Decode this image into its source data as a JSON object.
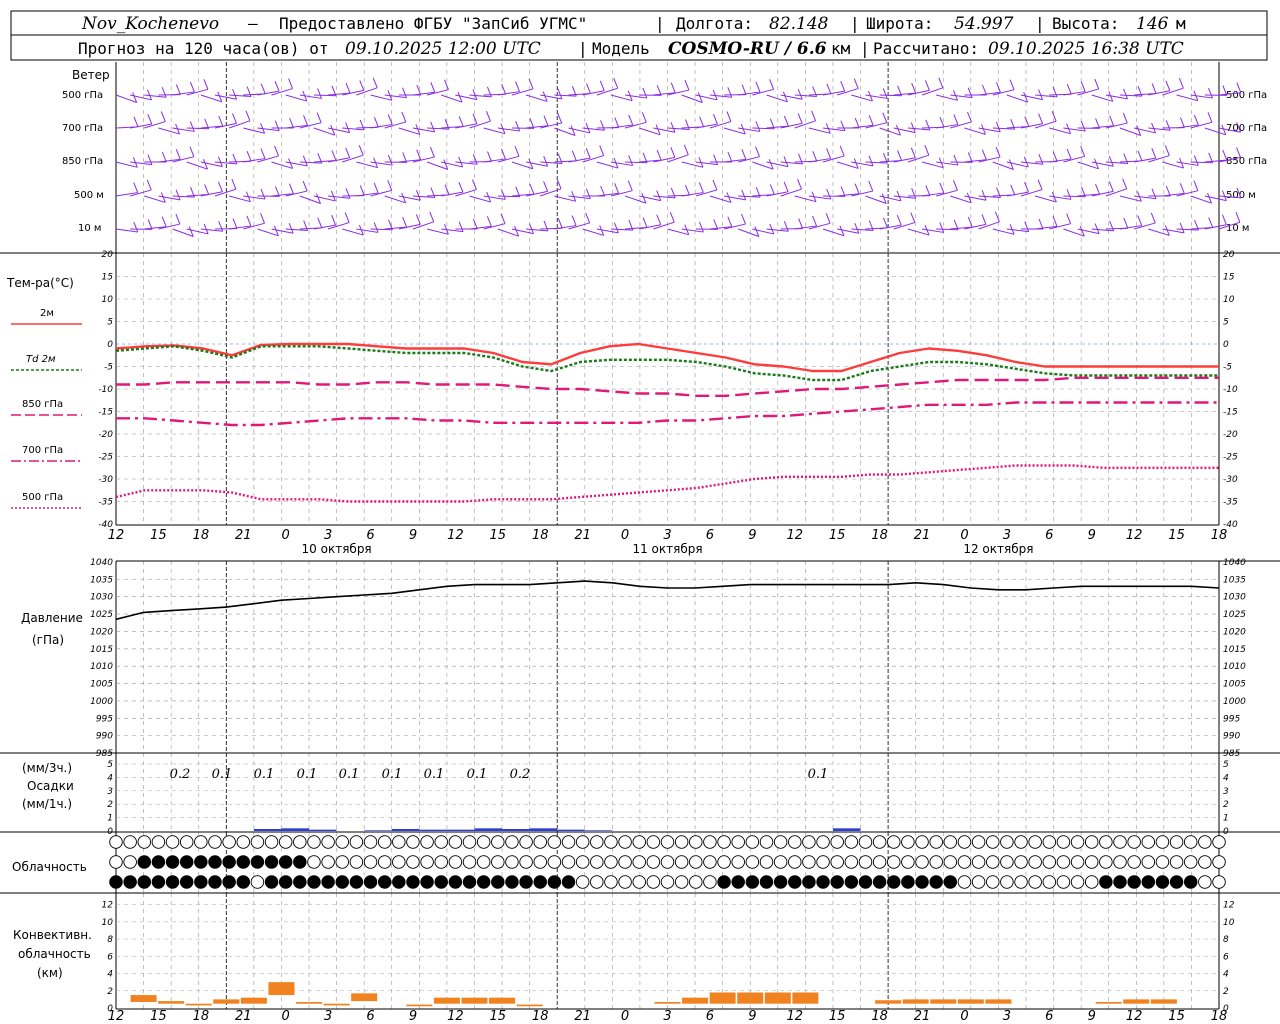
{
  "header": {
    "station": "Nov_Kochenevo",
    "dash": "–",
    "provider": "Предоставлено ФГБУ \"ЗапСиб УГМС\"",
    "lon_label": "Долгота:",
    "lon": "82.148",
    "lat_label": "Широта:",
    "lat": "54.997",
    "alt_label": "Высота:",
    "alt": "146",
    "alt_unit": "м",
    "forecast_label": "Прогноз на 120 часа(ов) от",
    "run_time": "09.10.2025 12:00 UTC",
    "model_label": "Модель",
    "model": "COSMO-RU / 6.6",
    "model_unit": "км",
    "calc_label": "Рассчитано:",
    "calc_time": "09.10.2025 16:38 UTC"
  },
  "x_ticks": [
    "12",
    "15",
    "18",
    "21",
    "0",
    "3",
    "6",
    "9",
    "12",
    "15",
    "18",
    "21",
    "0",
    "3",
    "6",
    "9",
    "12",
    "15",
    "18",
    "21",
    "0",
    "3",
    "6",
    "9",
    "12",
    "15",
    "18"
  ],
  "day_labels": [
    "10 октября",
    "11 октября",
    "12 октября"
  ],
  "wind_panel": {
    "title": "Ветер",
    "levels": [
      "500 гПа",
      "700 гПа",
      "850 гПа",
      "500 м",
      "10  м"
    ],
    "color": "#8a2be2"
  },
  "temp_panel": {
    "title": "Тем-ра(°С)",
    "yticks": [
      "20",
      "15",
      "10",
      "5",
      "0",
      "-5",
      "-10",
      "-15",
      "-20",
      "-25",
      "-30",
      "-35",
      "-40"
    ],
    "legend": [
      {
        "label": "2м",
        "color": "#ff3b3b"
      },
      {
        "label": "Td  2м",
        "color": "#1a7a1a"
      },
      {
        "label": "850 гПа",
        "color": "#e0187a"
      },
      {
        "label": "700 гПа",
        "color": "#e0187a"
      },
      {
        "label": "500 гПа",
        "color": "#e0187a"
      }
    ]
  },
  "pressure_panel": {
    "title": "Давление",
    "unit": "(гПа)",
    "yticks": [
      "1040",
      "1035",
      "1030",
      "1025",
      "1020",
      "1015",
      "1010",
      "1005",
      "1000",
      "995",
      "990",
      "985"
    ]
  },
  "precip_panel": {
    "label_3h": "(мм/3ч.)",
    "title": "Осадки",
    "label_1h": "(мм/1ч.)",
    "yticks": [
      "5",
      "4",
      "3",
      "2",
      "1",
      "0"
    ],
    "amounts": [
      "0.2",
      "0.1",
      "0.1",
      "0.1",
      "0.1",
      "0.1",
      "0.1",
      "0.1",
      "0.2",
      "0.1"
    ]
  },
  "cloud_panel": {
    "title": "Облачность"
  },
  "conv_panel": {
    "title_1": "Конвективн.",
    "title_2": "облачность",
    "unit": "(км)",
    "yticks": [
      "12",
      "10",
      "8",
      "6",
      "4",
      "2",
      "0"
    ]
  },
  "chart_data": [
    {
      "type": "line",
      "title": "Тем-ра(°С)",
      "x_hours": [
        0,
        6,
        12,
        15,
        18,
        21,
        24,
        27,
        30,
        33,
        36,
        39,
        42,
        45,
        48,
        51,
        54,
        57,
        60,
        63,
        66,
        69,
        72,
        75,
        78,
        81,
        84,
        87,
        90,
        93,
        96,
        99,
        102,
        105,
        108,
        111,
        114,
        117,
        120
      ],
      "ylim": [
        -40,
        20
      ],
      "series": [
        {
          "name": "2м",
          "values": [
            -1,
            -0.5,
            -0.3,
            -1.0,
            -2.5,
            -0.2,
            0,
            0,
            0,
            -0.5,
            -1,
            -1,
            -1,
            -2,
            -4,
            -4.5,
            -2,
            -0.5,
            0,
            -1,
            -2,
            -3,
            -4.5,
            -5,
            -6,
            -6,
            -4,
            -2,
            -1,
            -1.5,
            -2.5,
            -4,
            -5,
            -5,
            -5,
            -5,
            -5,
            -5,
            -5
          ]
        },
        {
          "name": "Td  2м",
          "values": [
            -1.5,
            -1,
            -0.5,
            -1.5,
            -3,
            -0.5,
            -0.5,
            -0.5,
            -1,
            -1.5,
            -2,
            -2,
            -2,
            -3,
            -5,
            -6,
            -4,
            -3.5,
            -3.5,
            -3.5,
            -4,
            -5,
            -6.5,
            -7,
            -8,
            -8,
            -6,
            -5,
            -4,
            -4,
            -4.5,
            -5.5,
            -6.5,
            -7,
            -7,
            -7,
            -7,
            -7,
            -7
          ]
        },
        {
          "name": "850 гПа",
          "values": [
            -9,
            -9,
            -8.5,
            -8.5,
            -8.5,
            -8.5,
            -8.5,
            -9,
            -9,
            -8.5,
            -8.5,
            -9,
            -9,
            -9,
            -9.5,
            -10,
            -10,
            -10.5,
            -11,
            -11,
            -11.5,
            -11.5,
            -11,
            -10.5,
            -10,
            -10,
            -9.5,
            -9,
            -8.5,
            -8,
            -8,
            -8,
            -8,
            -7.5,
            -7.5,
            -7.5,
            -7.5,
            -7.5,
            -7.5
          ]
        },
        {
          "name": "700 гПа",
          "values": [
            -16.5,
            -16.5,
            -17,
            -17.5,
            -18,
            -18,
            -17.5,
            -17,
            -16.5,
            -16.5,
            -16.5,
            -17,
            -17,
            -17.5,
            -17.5,
            -17.5,
            -17.5,
            -17.5,
            -17.5,
            -17,
            -17,
            -16.5,
            -16,
            -16,
            -15.5,
            -15,
            -14.5,
            -14,
            -13.5,
            -13.5,
            -13.5,
            -13,
            -13,
            -13,
            -13,
            -13,
            -13,
            -13,
            -13
          ]
        },
        {
          "name": "500 гПа",
          "values": [
            -34,
            -32.5,
            -32.5,
            -32.5,
            -33,
            -34.5,
            -34.5,
            -34.5,
            -35,
            -35,
            -35,
            -35,
            -35,
            -34.5,
            -34.5,
            -34.5,
            -34,
            -33.5,
            -33,
            -32.5,
            -32,
            -31,
            -30,
            -29.5,
            -29.5,
            -29.5,
            -29,
            -29,
            -28.5,
            -28,
            -27.5,
            -27,
            -27,
            -27,
            -27.5,
            -27.5,
            -27.5,
            -27.5,
            -27.5
          ]
        }
      ]
    },
    {
      "type": "line",
      "title": "Давление",
      "x_hours": [
        0,
        3,
        6,
        9,
        12,
        15,
        18,
        21,
        24,
        27,
        30,
        33,
        36,
        39,
        42,
        45,
        48,
        51,
        54,
        57,
        60,
        63,
        66,
        69,
        72,
        75,
        78,
        81,
        84,
        87,
        90,
        93,
        96,
        99,
        102,
        105,
        108,
        111,
        114,
        117,
        120
      ],
      "ylim": [
        985,
        1040
      ],
      "series": [
        {
          "name": "",
          "values": [
            1023.5,
            1025.5,
            1026,
            1026.5,
            1027,
            1028,
            1029,
            1029.5,
            1030,
            1030.5,
            1031,
            1032,
            1033,
            1033.5,
            1033.5,
            1033.5,
            1034,
            1034.5,
            1034,
            1033,
            1032.5,
            1032.5,
            1033,
            1033.5,
            1033.5,
            1033.5,
            1033.5,
            1033.5,
            1033.5,
            1034,
            1033.5,
            1032.5,
            1032,
            1032,
            1032.5,
            1033,
            1033,
            1033,
            1033,
            1033,
            1032.5
          ]
        }
      ]
    },
    {
      "type": "bar",
      "title": "Осадки",
      "x_hours": [
        15,
        18,
        21,
        27,
        30,
        33,
        36,
        39,
        42,
        45,
        48,
        51,
        78
      ],
      "ylim": [
        0,
        5
      ],
      "series": [
        {
          "name": "",
          "values": [
            0.15,
            0.2,
            0.1,
            0.05,
            0.15,
            0.1,
            0.1,
            0.2,
            0.15,
            0.2,
            0.1,
            0.05,
            0.2
          ]
        }
      ]
    },
    {
      "type": "bar",
      "title": "Конвективн. облачность",
      "x_hours": [
        0,
        3,
        6,
        9,
        12,
        15,
        18,
        21,
        24,
        27,
        30,
        33,
        36,
        39,
        42,
        45,
        48,
        51,
        54,
        57,
        60,
        63,
        66,
        69,
        72,
        75,
        78,
        81,
        84,
        87,
        90,
        93,
        96,
        99,
        102,
        105,
        108,
        111,
        114,
        117,
        120
      ],
      "ylim": [
        0,
        12
      ],
      "series": [
        {
          "name": "bottom",
          "values": [
            0,
            0.7,
            0.5,
            0.3,
            0.5,
            0.5,
            1.5,
            0.5,
            0.3,
            0.8,
            0.5,
            0.2,
            0.5,
            0.5,
            0.5,
            0.2,
            0,
            0,
            0,
            0,
            0.5,
            0.5,
            0.5,
            0.5,
            0.5,
            0.5,
            0,
            0,
            0.5,
            0.5,
            0.5,
            0.5,
            0.5,
            0,
            0,
            0,
            0.5,
            0.5,
            0.5,
            0,
            0
          ]
        },
        {
          "name": "top",
          "values": [
            0,
            1.5,
            0.8,
            0.5,
            1.0,
            1.2,
            3.0,
            0.7,
            0.5,
            1.7,
            0.5,
            0.4,
            1.2,
            1.2,
            1.2,
            0.4,
            0,
            0,
            0,
            0,
            0.7,
            1.2,
            1.8,
            1.8,
            1.8,
            1.8,
            0,
            0,
            0.9,
            1.0,
            1.0,
            1.0,
            1.0,
            0,
            0,
            0,
            0.7,
            1.0,
            1.0,
            0,
            0
          ]
        }
      ]
    }
  ]
}
